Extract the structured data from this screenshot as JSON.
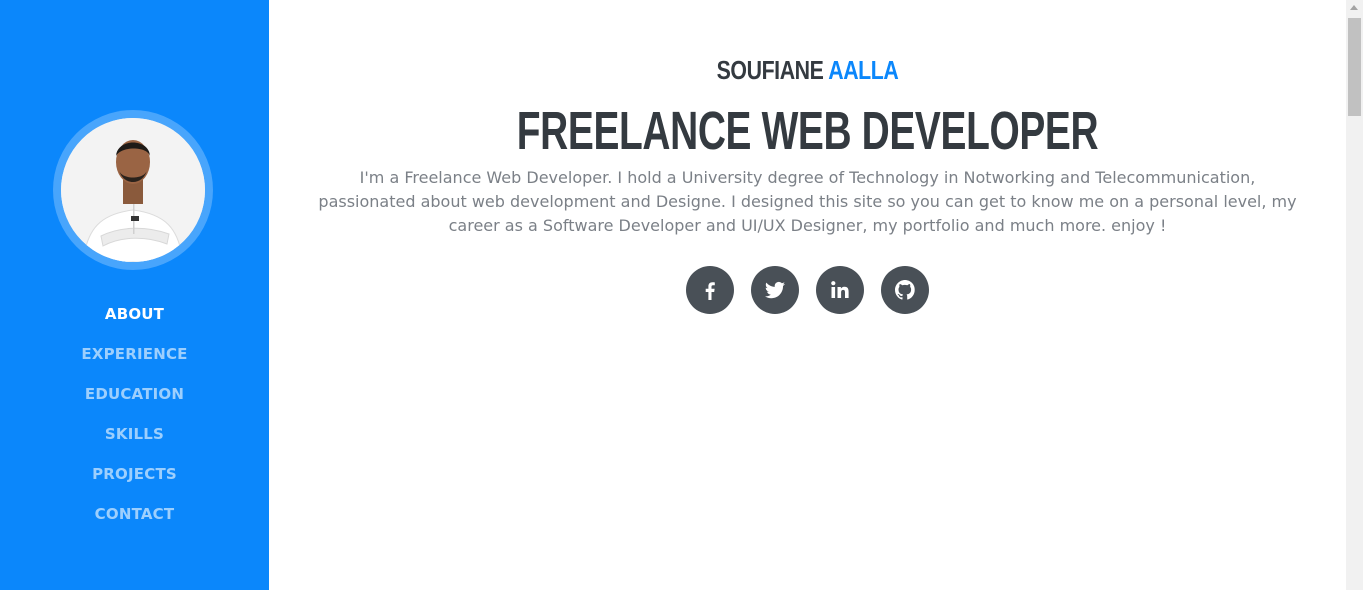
{
  "sidebar": {
    "avatar_alt": "profile photo",
    "nav": [
      {
        "label": "ABOUT",
        "active": true
      },
      {
        "label": "EXPERIENCE",
        "active": false
      },
      {
        "label": "EDUCATION",
        "active": false
      },
      {
        "label": "SKILLS",
        "active": false
      },
      {
        "label": "PROJECTS",
        "active": false
      },
      {
        "label": "CONTACT",
        "active": false
      }
    ]
  },
  "main": {
    "name_first": "SOUFIANE",
    "name_last": "AALLA",
    "headline": "FREELANCE WEB DEVELOPER",
    "bio": "I'm a Freelance Web Developer. I hold a University degree of Technology in Notworking and Telecommunication, passionated about web development and Designe. I designed this site so you can get to know me on a personal level, my career as a Software Developer and UI/UX Designer, my portfolio and much more. enjoy !",
    "social": [
      {
        "icon": "facebook-icon"
      },
      {
        "icon": "twitter-icon"
      },
      {
        "icon": "linkedin-icon"
      },
      {
        "icon": "github-icon"
      }
    ]
  },
  "colors": {
    "accent": "#0b87fb",
    "text_dark": "#343a40",
    "text_muted": "#7b8087",
    "social_bg": "#495057"
  }
}
